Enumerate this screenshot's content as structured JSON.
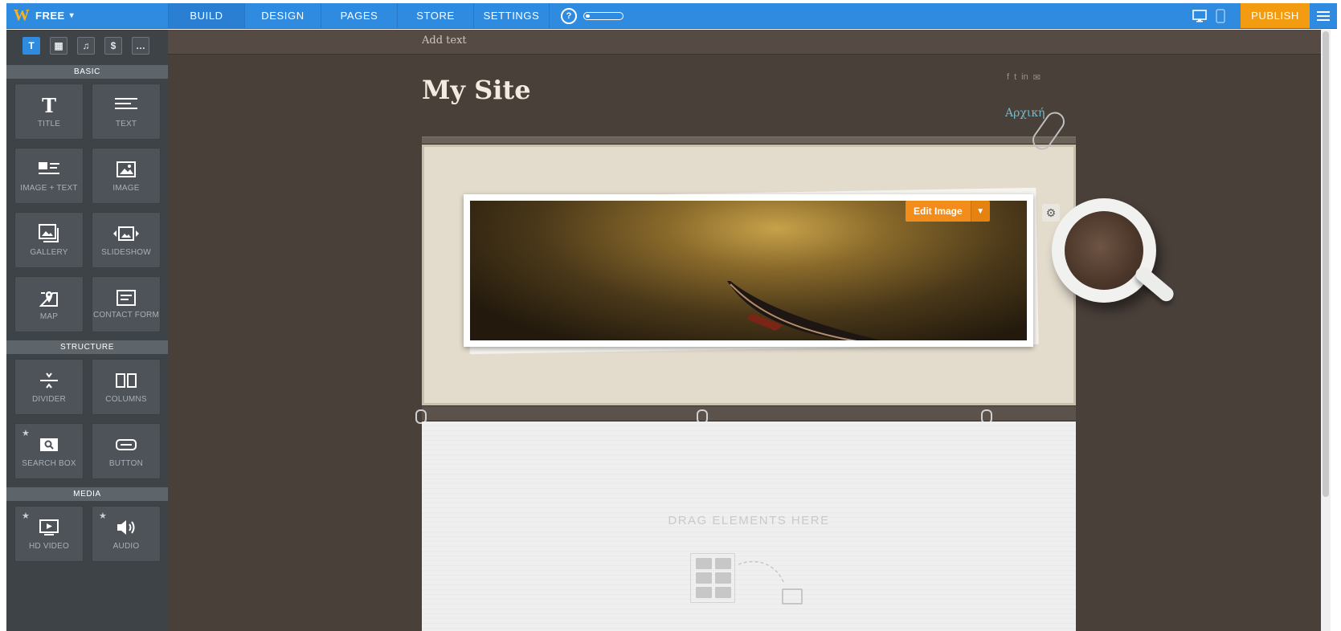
{
  "topbar": {
    "brand": "FREE",
    "tabs": [
      {
        "label": "BUILD",
        "active": true
      },
      {
        "label": "DESIGN",
        "active": false
      },
      {
        "label": "PAGES",
        "active": false
      },
      {
        "label": "STORE",
        "active": false
      },
      {
        "label": "SETTINGS",
        "active": false
      }
    ],
    "help": "?",
    "publish": "PUBLISH",
    "progress": 0.1,
    "icons": [
      "weebly-logo-icon",
      "chevron-down-icon",
      "help-icon",
      "desktop-icon",
      "mobile-icon",
      "hamburger-menu-icon"
    ]
  },
  "sidebar": {
    "tabs": [
      "T",
      "▦",
      "♫",
      "$",
      "…"
    ],
    "sections": [
      {
        "title": "BASIC",
        "items": [
          {
            "label": "TITLE",
            "icon": "title-icon",
            "starred": false
          },
          {
            "label": "TEXT",
            "icon": "text-icon",
            "starred": false
          },
          {
            "label": "IMAGE + TEXT",
            "icon": "image-text-icon",
            "starred": false
          },
          {
            "label": "IMAGE",
            "icon": "image-icon",
            "starred": false
          },
          {
            "label": "GALLERY",
            "icon": "gallery-icon",
            "starred": false
          },
          {
            "label": "SLIDESHOW",
            "icon": "slideshow-icon",
            "starred": false
          },
          {
            "label": "MAP",
            "icon": "map-icon",
            "starred": false
          },
          {
            "label": "CONTACT FORM",
            "icon": "contact-form-icon",
            "starred": false
          }
        ]
      },
      {
        "title": "STRUCTURE",
        "items": [
          {
            "label": "DIVIDER",
            "icon": "divider-icon",
            "starred": false
          },
          {
            "label": "COLUMNS",
            "icon": "columns-icon",
            "starred": false
          },
          {
            "label": "SEARCH BOX",
            "icon": "search-box-icon",
            "starred": true
          },
          {
            "label": "BUTTON",
            "icon": "button-icon",
            "starred": false
          }
        ]
      },
      {
        "title": "MEDIA",
        "items": [
          {
            "label": "HD VIDEO",
            "icon": "hd-video-icon",
            "starred": true
          },
          {
            "label": "AUDIO",
            "icon": "audio-icon",
            "starred": true
          }
        ]
      }
    ]
  },
  "canvas": {
    "add_text": "Add text",
    "site_title": "My Site",
    "nav_link": "Αρχική",
    "edit_image": "Edit Image",
    "drag_here": "DRAG ELEMENTS HERE",
    "social_icons": [
      "f",
      "t",
      "in",
      "✉"
    ]
  },
  "colors": {
    "topbar": "#2f8be0",
    "publish": "#f39c12",
    "sidebar": "#3e4347",
    "canvas": "#4a403a"
  }
}
